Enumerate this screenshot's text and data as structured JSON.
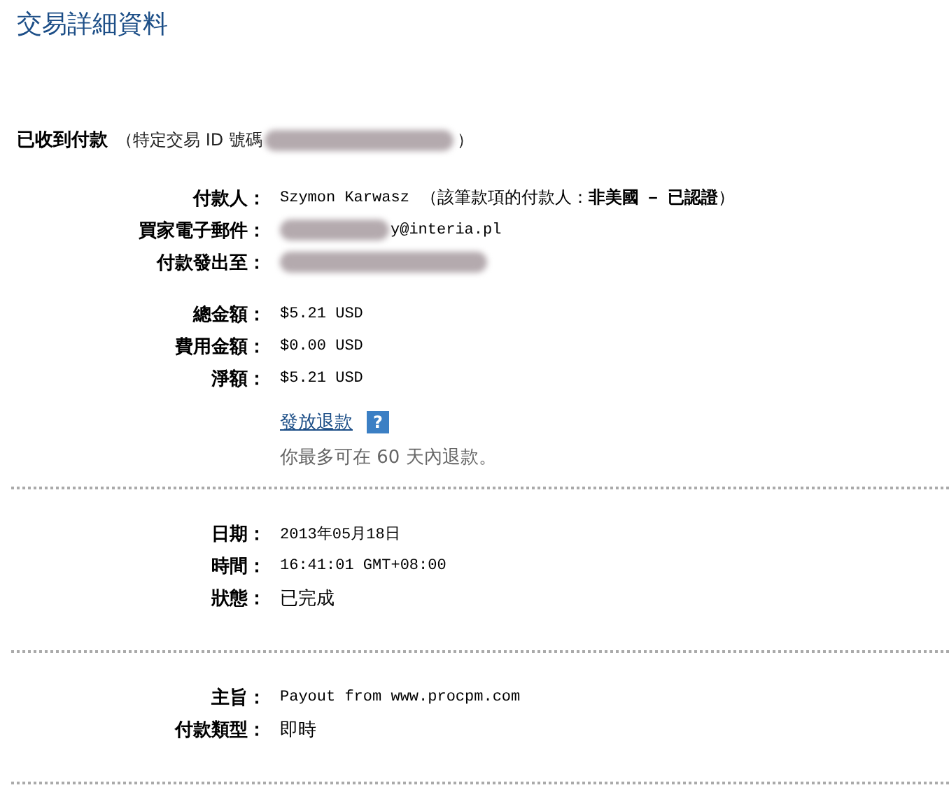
{
  "title": "交易詳細資料",
  "status": {
    "label": "已收到付款",
    "id_label": "（特定交易 ID 號碼",
    "id_close": "）"
  },
  "sections": [
    {
      "groups": [
        {
          "rows": [
            {
              "label": "付款人：",
              "kind": "mono",
              "value": "Szymon Karwasz",
              "note": "（該筆款項的付款人：**非美國 － 已認證**）"
            },
            {
              "label": "買家電子郵件：",
              "kind": "blurred_prefix",
              "value": "y@interia.pl"
            },
            {
              "label": "付款發出至：",
              "kind": "blurred"
            }
          ]
        },
        {
          "rows": [
            {
              "label": "總金額：",
              "kind": "mono",
              "value": "$5.21 USD"
            },
            {
              "label": "費用金額：",
              "kind": "mono",
              "value": "$0.00 USD"
            },
            {
              "label": "淨額：",
              "kind": "mono",
              "value": "$5.21 USD"
            }
          ]
        }
      ],
      "refund": {
        "link": "發放退款",
        "help": "?",
        "note": "你最多可在 60 天內退款。"
      }
    },
    {
      "groups": [
        {
          "rows": [
            {
              "label": "日期：",
              "kind": "mono",
              "value": "2013年05月18日"
            },
            {
              "label": "時間：",
              "kind": "mono",
              "value": "16:41:01 GMT+08:00"
            },
            {
              "label": "狀態：",
              "kind": "text",
              "value": "已完成"
            }
          ]
        }
      ]
    },
    {
      "groups": [
        {
          "rows": [
            {
              "label": "主旨：",
              "kind": "mono",
              "value": "Payout from www.procpm.com"
            },
            {
              "label": "付款類型：",
              "kind": "text",
              "value": "即時"
            }
          ]
        }
      ]
    }
  ]
}
